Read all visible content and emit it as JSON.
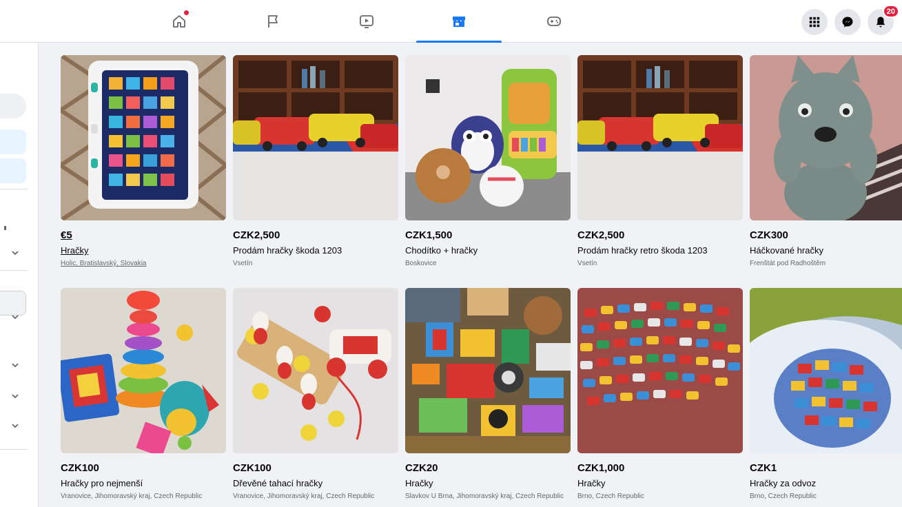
{
  "topnav": {
    "tabs": [
      {
        "icon": "home-icon",
        "active": false,
        "has_dot": true
      },
      {
        "icon": "flag-icon",
        "active": false
      },
      {
        "icon": "video-icon",
        "active": false
      },
      {
        "icon": "marketplace-icon",
        "active": true
      },
      {
        "icon": "gaming-icon",
        "active": false
      }
    ],
    "right_buttons": [
      {
        "icon": "menu-grid-icon"
      },
      {
        "icon": "messenger-icon"
      },
      {
        "icon": "bell-icon",
        "badge": "20"
      }
    ],
    "accent_color": "#1877f2"
  },
  "listings": [
    {
      "price": "€5",
      "title": "Hračky",
      "location": "Holic, Bratislavský, Slovakia"
    },
    {
      "price": "CZK2,500",
      "title": "Prodám hračky škoda 1203",
      "location": "Vsetín"
    },
    {
      "price": "CZK1,500",
      "title": "Chodítko + hračky",
      "location": "Boskovice"
    },
    {
      "price": "CZK2,500",
      "title": "Prodám hračky retro škoda 1203",
      "location": "Vsetín"
    },
    {
      "price": "CZK300",
      "title": "Háčkované hračky",
      "location": "Frenštát pod Radhoštěm"
    },
    {
      "price": "CZK100",
      "title": "Hračky pro nejmenší",
      "location": "Vranovice, Jihomoravský kraj, Czech Republic"
    },
    {
      "price": "CZK100",
      "title": "Dřevěné tahací hračky",
      "location": "Vranovice, Jihomoravský kraj, Czech Republic"
    },
    {
      "price": "CZK20",
      "title": "Hračky",
      "location": "Slavkov U Brna, Jihomoravský kraj, Czech Republic"
    },
    {
      "price": "CZK1,000",
      "title": "Hračky",
      "location": "Brno, Czech Republic"
    },
    {
      "price": "CZK1",
      "title": "Hračky za odvoz",
      "location": "Brno, Czech Republic"
    }
  ]
}
